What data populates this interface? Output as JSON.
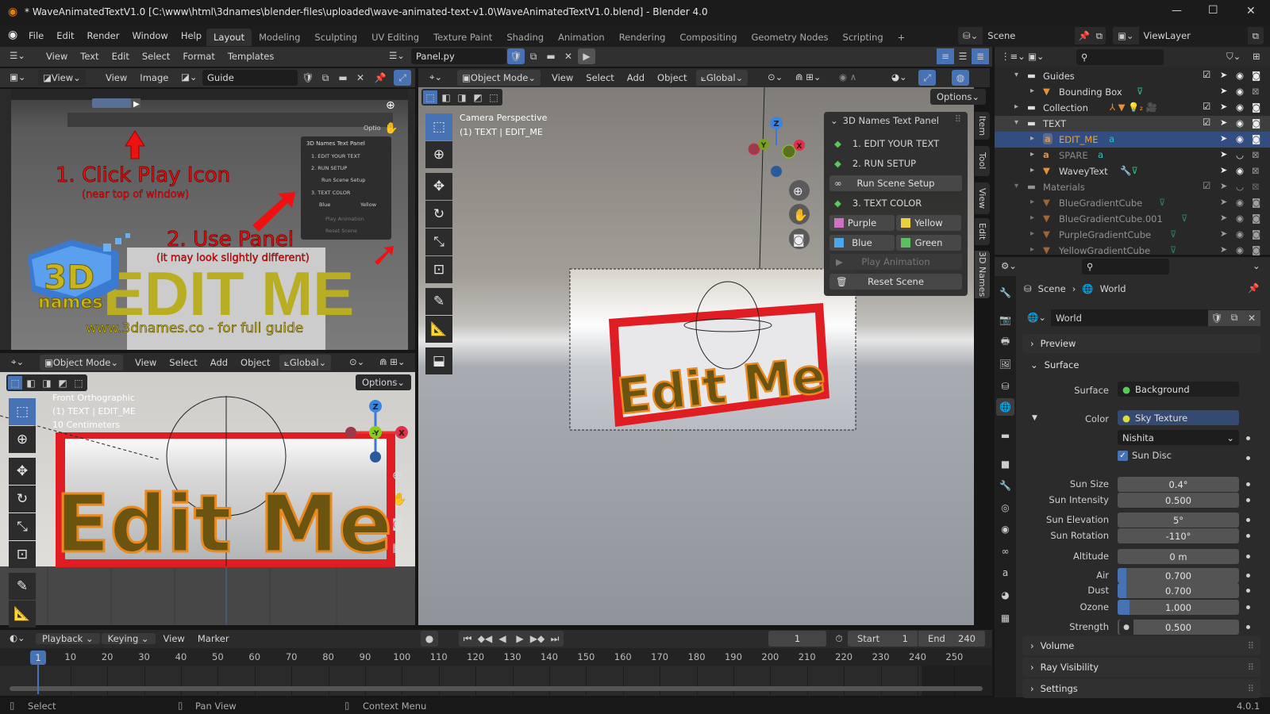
{
  "window": {
    "title": "* WaveAnimatedTextV1.0 [C:\\www\\html\\3dnames\\blender-files\\uploaded\\wave-animated-text-v1.0\\WaveAnimatedTextV1.0.blend] - Blender 4.0",
    "minimize": "—",
    "maximize": "☐",
    "close": "✕"
  },
  "topbar": {
    "menus": [
      "File",
      "Edit",
      "Render",
      "Window",
      "Help"
    ],
    "workspaces": [
      "Layout",
      "Modeling",
      "Sculpting",
      "UV Editing",
      "Texture Paint",
      "Shading",
      "Animation",
      "Rendering",
      "Compositing",
      "Geometry Nodes",
      "Scripting",
      "+"
    ],
    "active_workspace": "Layout",
    "scene": "Scene",
    "view_layer": "ViewLayer"
  },
  "text_editor": {
    "menus": [
      "View",
      "Text",
      "Edit",
      "Select",
      "Format",
      "Templates"
    ],
    "file": "Panel.py"
  },
  "image_editor": {
    "view_dropdown": "View",
    "menus": [
      "View",
      "Image"
    ],
    "image": "Guide"
  },
  "guide_image": {
    "step1": "1. Click Play Icon",
    "step1_note": "(near top of window)",
    "step2": "2. Use Panel",
    "step2_note": "(it may look slightly different)",
    "sample_text": "EDIT ME",
    "logo_3d": "3D",
    "logo_names": "names",
    "url": "www.3dnames.co - for full guide",
    "mini_panel": {
      "title": "3D Names Text Panel",
      "items": [
        "1. EDIT YOUR TEXT",
        "2. RUN SETUP",
        "Run Scene Setup",
        "3. TEXT COLOR",
        "Blue",
        "Yellow",
        "Play Animation",
        "Reset Scene"
      ]
    },
    "options": "Optio"
  },
  "front_view": {
    "mode": "Object Mode",
    "menus": [
      "View",
      "Select",
      "Add",
      "Object"
    ],
    "orientation": "Global",
    "options": "Options",
    "info": [
      "Front Orthographic",
      "(1) TEXT | EDIT_ME",
      "10 Centimeters"
    ],
    "object_text": "Edit Me",
    "gizmo": {
      "z": "Z",
      "y": "-Y",
      "x": "X"
    }
  },
  "main_view": {
    "mode": "Object Mode",
    "menus": [
      "View",
      "Select",
      "Add",
      "Object"
    ],
    "orientation": "Global",
    "options": "Options",
    "info": [
      "Camera Perspective",
      "(1) TEXT | EDIT_ME"
    ],
    "object_text": "Edit Me",
    "gizmo": {
      "z": "Z",
      "y": "Y",
      "x": "X"
    }
  },
  "npanel": {
    "tabs": [
      "Item",
      "Tool",
      "View",
      "Edit",
      "3D Names"
    ],
    "active_tab": "3D Names",
    "title": "3D Names Text Panel",
    "step1": "1. EDIT YOUR TEXT",
    "step2": "2. RUN SETUP",
    "run_setup": "Run Scene Setup",
    "step3": "3. TEXT COLOR",
    "colors": [
      {
        "label": "Purple",
        "swatch": "#d070c0"
      },
      {
        "label": "Yellow",
        "swatch": "#e8d040"
      },
      {
        "label": "Blue",
        "swatch": "#4aa8e8"
      },
      {
        "label": "Green",
        "swatch": "#5cc060"
      }
    ],
    "play": "Play Animation",
    "reset": "Reset Scene"
  },
  "outliner": {
    "rows": [
      {
        "label": "Guides",
        "depth": 0,
        "type": "collection",
        "expanded": true,
        "checkbox": true,
        "camera": true
      },
      {
        "label": "Bounding Box",
        "depth": 1,
        "type": "mesh",
        "extra": "mesh-data",
        "camera": false
      },
      {
        "label": "Collection",
        "depth": 0,
        "type": "collection",
        "expanded": false,
        "checkbox": true,
        "extra": "empty-mesh-light-camera",
        "camera": true
      },
      {
        "label": "TEXT",
        "depth": 0,
        "type": "collection",
        "expanded": true,
        "checkbox": true,
        "highlight": true,
        "camera": true
      },
      {
        "label": "EDIT_ME",
        "depth": 1,
        "type": "text",
        "selected": true,
        "extra": "text-data",
        "camera": true
      },
      {
        "label": "SPARE",
        "depth": 1,
        "type": "text",
        "hidden": true,
        "extra": "text-data",
        "camera": false
      },
      {
        "label": "WaveyText",
        "depth": 1,
        "type": "mesh",
        "extra": "modifier-mesh",
        "camera": false
      },
      {
        "label": "Materials",
        "depth": 0,
        "type": "collection",
        "expanded": true,
        "checkbox": true,
        "hidden": true,
        "dim": true,
        "camera": false
      },
      {
        "label": "BlueGradientCube",
        "depth": 1,
        "type": "mesh",
        "extra": "mesh-data",
        "dim": true,
        "camera": true
      },
      {
        "label": "BlueGradientCube.001",
        "depth": 1,
        "type": "mesh",
        "extra": "mesh-data",
        "dim": true,
        "camera": true
      },
      {
        "label": "PurpleGradientCube",
        "depth": 1,
        "type": "mesh",
        "extra": "mesh-data",
        "dim": true,
        "camera": true
      },
      {
        "label": "YellowGradientCube",
        "depth": 1,
        "type": "mesh",
        "extra": "mesh-data",
        "dim": true,
        "camera": true
      }
    ]
  },
  "properties": {
    "breadcrumb": [
      "Scene",
      "World"
    ],
    "world": "World",
    "preview": "Preview",
    "surface_section": "Surface",
    "surface_label": "Surface",
    "surface_value": "Background",
    "color_label": "Color",
    "color_value": "Sky Texture",
    "sky_type": "Nishita",
    "sun_disc": "Sun Disc",
    "sun_disc_checked": true,
    "fields": [
      {
        "label": "Sun Size",
        "value": "0.4°"
      },
      {
        "label": "Sun Intensity",
        "value": "0.500"
      },
      {
        "label": "Sun Elevation",
        "value": "5°"
      },
      {
        "label": "Sun Rotation",
        "value": "-110°"
      },
      {
        "label": "Altitude",
        "value": "0 m"
      },
      {
        "label": "Air",
        "value": "0.700",
        "fill": 0.07
      },
      {
        "label": "Dust",
        "value": "0.700",
        "fill": 0.07
      },
      {
        "label": "Ozone",
        "value": "1.000",
        "fill": 0.1
      },
      {
        "label": "Strength",
        "value": "0.500"
      }
    ],
    "sections": [
      "Volume",
      "Ray Visibility",
      "Settings"
    ],
    "accent": "#4772b3"
  },
  "timeline": {
    "menus": [
      "Playback",
      "Keying",
      "View",
      "Marker"
    ],
    "current_frame": "1",
    "start_label": "Start",
    "start": "1",
    "end_label": "End",
    "end": "240",
    "ticks": [
      "10",
      "20",
      "30",
      "40",
      "50",
      "60",
      "70",
      "80",
      "90",
      "100",
      "110",
      "120",
      "130",
      "140",
      "150",
      "160",
      "170",
      "180",
      "190",
      "200",
      "210",
      "220",
      "230",
      "240",
      "250"
    ],
    "playhead": "1"
  },
  "status": {
    "items": [
      "Select",
      "Pan View",
      "Context Menu"
    ],
    "version": "4.0.1"
  }
}
